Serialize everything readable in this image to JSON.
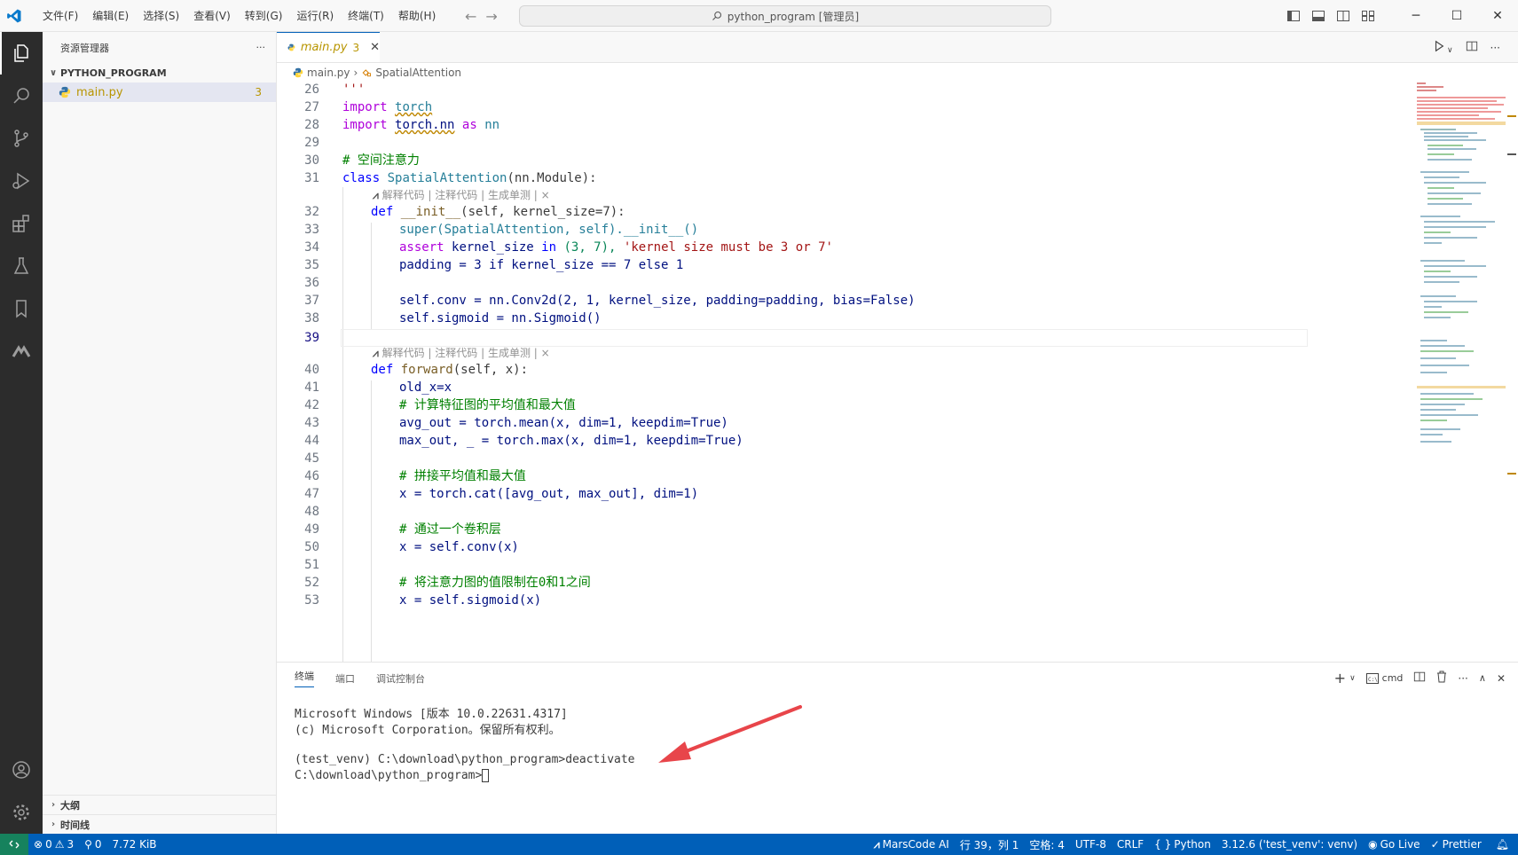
{
  "titlebar": {
    "menu": [
      "文件(F)",
      "编辑(E)",
      "选择(S)",
      "查看(V)",
      "转到(G)",
      "运行(R)",
      "终端(T)",
      "帮助(H)"
    ],
    "search_text": "python_program [管理员]"
  },
  "sidebar": {
    "title": "资源管理器",
    "more": "···",
    "folder": "PYTHON_PROGRAM",
    "file": "main.py",
    "file_problems": "3",
    "outline": "大纲",
    "timeline": "时间线"
  },
  "editor": {
    "tab_name": "main.py",
    "tab_problems": "3",
    "breadcrumb_file": "main.py",
    "breadcrumb_symbol": "SpatialAttention",
    "codelens": "解释代码 | 注释代码 | 生成单测 | ×",
    "line_numbers": [
      "26",
      "27",
      "28",
      "29",
      "30",
      "31",
      "32",
      "33",
      "34",
      "35",
      "36",
      "37",
      "38",
      "39",
      "40",
      "41",
      "42",
      "43",
      "44",
      "45",
      "46",
      "47",
      "48",
      "49",
      "50",
      "51",
      "52",
      "53"
    ],
    "code": {
      "l26": "'''",
      "l27_kw": "import",
      "l27_mod": "torch",
      "l28_kw": "import",
      "l28_mod": "torch.nn",
      "l28_as": "as",
      "l28_alias": "nn",
      "l30": "# 空间注意力",
      "l31_kw": "class",
      "l31_name": "SpatialAttention",
      "l31_rest": "(nn.Module):",
      "l32_kw": "def",
      "l32_fn": "__init__",
      "l32_rest": "(self, kernel_size=7):",
      "l33": "super(SpatialAttention, self).__init__()",
      "l34_kw": "assert",
      "l34_mid": "kernel_size",
      "l34_in": "in",
      "l34_tuple": "(3, 7),",
      "l34_str": "'kernel size must be 3 or 7'",
      "l35": "padding = 3 if kernel_size == 7 else 1",
      "l37": "self.conv = nn.Conv2d(2, 1, kernel_size, padding=padding, bias=False)",
      "l38": "self.sigmoid = nn.Sigmoid()",
      "l40_kw": "def",
      "l40_fn": "forward",
      "l40_rest": "(self, x):",
      "l41": "old_x=x",
      "l42": "# 计算特征图的平均值和最大值",
      "l43": "avg_out = torch.mean(x, dim=1, keepdim=True)",
      "l44": "max_out, _ = torch.max(x, dim=1, keepdim=True)",
      "l46": "# 拼接平均值和最大值",
      "l47": "x = torch.cat([avg_out, max_out], dim=1)",
      "l49": "# 通过一个卷积层",
      "l50": "x = self.conv(x)",
      "l52": "# 将注意力图的值限制在0和1之间",
      "l53": "x = self.sigmoid(x)"
    }
  },
  "panel": {
    "tabs": [
      "终端",
      "端口",
      "调试控制台"
    ],
    "shell": "cmd",
    "terminal_lines": [
      "Microsoft Windows [版本 10.0.22631.4317]",
      "(c) Microsoft Corporation。保留所有权利。",
      "",
      "(test_venv) C:\\download\\python_program>deactivate",
      "C:\\download\\python_program>"
    ]
  },
  "statusbar": {
    "errors": "0",
    "warnings": "3",
    "ports": "0",
    "size": "7.72 KiB",
    "marscode": "MarsCode AI",
    "position": "行 39，列 1",
    "spaces": "空格: 4",
    "encoding": "UTF-8",
    "eol": "CRLF",
    "language": "Python",
    "interpreter": "3.12.6 ('test_venv': venv)",
    "golive": "Go Live",
    "prettier": "Prettier"
  },
  "colors": {
    "accent": "#005fb8",
    "activity_bar": "#2c2c2c",
    "warning": "#b89500",
    "remote": "#16825d",
    "arrow": "#e8454a"
  }
}
